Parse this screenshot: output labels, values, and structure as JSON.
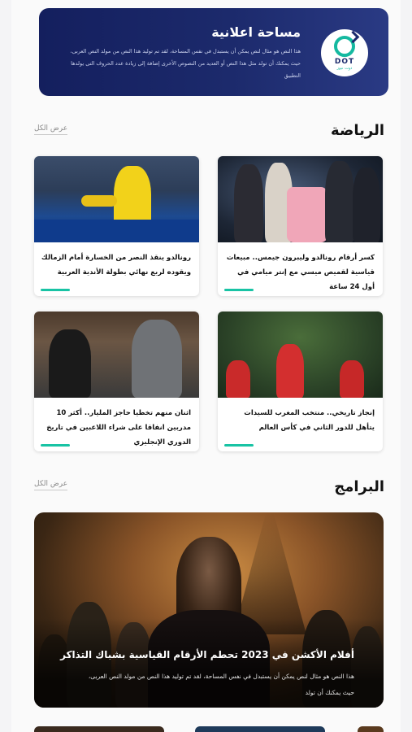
{
  "ad": {
    "title": "مساحة اعلانية",
    "text": "هذا النص هو مثال لنص يمكن أن يستبدل في نفس المساحة، لقد تم توليد هذا النص من مولد النص العربى، حيث يمكنك أن تولد مثل هذا النص أو العديد من النصوص الأخرى إضافة إلى زيادة عدد الحروف التى يولدها التطبيق",
    "logo_text": "DOT",
    "logo_subtext": "دوت نيوز"
  },
  "sports": {
    "title": "الرياضة",
    "see_all": "عرض الكل",
    "articles": [
      {
        "headline": "كسر أرقام رونالدو وليبرون جيمس.. مبيعات قياسية لقميص ميسي مع إنتر ميامي في أول 24 ساعة"
      },
      {
        "headline": "رونالدو ينقذ النصر من الخسارة أمام الزمالك ويقوده لربع نهائي بطولة الأندية العربية"
      },
      {
        "headline": "إنجاز تاريخي.. منتخب المغرب للسيدات يتأهل للدور الثاني في كأس العالم"
      },
      {
        "headline": "اثنان منهم تخطيا حاجز المليار.. أكثر 10 مدربين انفاقا على شراء اللاعبين في تاريخ الدوري الإنجليزي"
      }
    ]
  },
  "programs": {
    "title": "البرامج",
    "see_all": "عرض الكل",
    "featured": {
      "headline": "أفلام الأكشن في 2023 تحطم الأرقام القياسية بشباك التذاكر",
      "description": "هذا النص هو مثال لنص يمكن أن يستبدل في نفس المساحة، لقد تم توليد هذا النص من مولد النص العربى، حيث يمكنك أن تولد"
    }
  },
  "colors": {
    "accent": "#18c3a4",
    "ad_background": "#1c2a6c",
    "text": "#111111",
    "muted": "#8a8a8a"
  }
}
